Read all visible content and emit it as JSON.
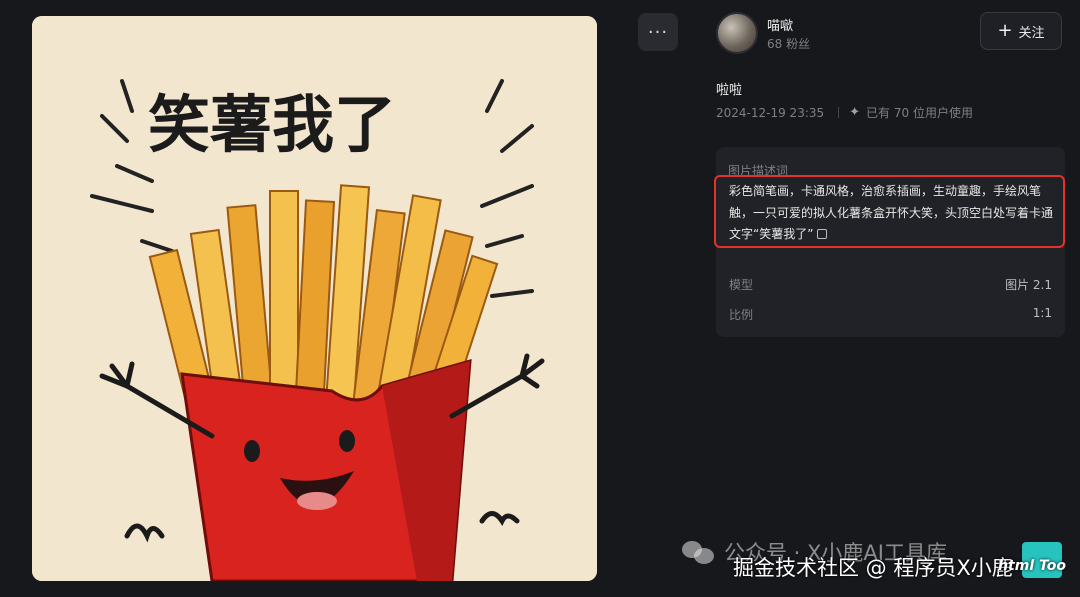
{
  "image": {
    "caption_text": "笑薯我了",
    "colors": {
      "background": "#f3e6cf",
      "box": "#d9231f",
      "fries": "#f0b63a"
    }
  },
  "toolbar": {
    "more_label": "···"
  },
  "author": {
    "name": "喵噷",
    "followers": "68 粉丝"
  },
  "follow_button": {
    "label": "关注"
  },
  "post": {
    "title": "啦啦",
    "date": "2024-12-19 23:35",
    "usage": "已有 70 位用户使用"
  },
  "prompt_panel": {
    "label": "图片描述词",
    "text": "彩色简笔画，卡通风格，治愈系插画，生动童趣，手绘风笔触，一只可爱的拟人化薯条盒开怀大笑，头顶空白处写着卡通文字“笑薯我了”"
  },
  "params": [
    {
      "label": "模型",
      "value": "图片 2.1"
    },
    {
      "label": "比例",
      "value": "1:1"
    }
  ],
  "watermarks": {
    "wechat": "公众号 · X小鹿AI工具库",
    "juejin": "掘金技术社区 @ 程序员X小鹿",
    "site": "html Too"
  },
  "accent_colors": {
    "highlight": "#e0342b",
    "bg": "#17181c",
    "panel": "#212227"
  }
}
